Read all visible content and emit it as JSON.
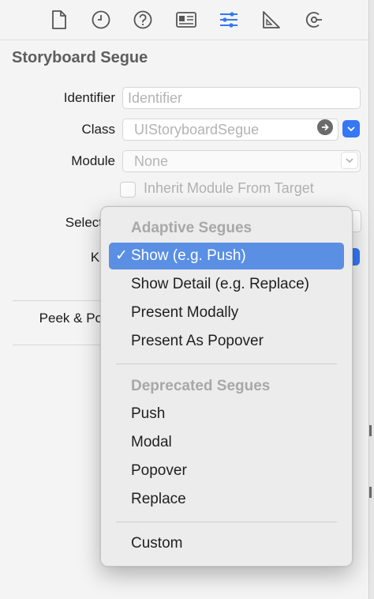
{
  "inspector": {
    "section_title": "Storyboard Segue",
    "identifier": {
      "label": "Identifier",
      "placeholder": "Identifier"
    },
    "class": {
      "label": "Class",
      "value": "UIStoryboardSegue"
    },
    "module": {
      "label": "Module",
      "value": "None"
    },
    "inherit_module": {
      "label": "Inherit Module From Target",
      "checked": false
    },
    "selector": {
      "label": "Select"
    },
    "kind": {
      "label": "Ki"
    },
    "peek_pop": {
      "label": "Peek & Po"
    }
  },
  "toolbar": {
    "icons": [
      "file-inspector-icon",
      "history-inspector-icon",
      "quick-help-icon",
      "identity-inspector-icon",
      "attributes-inspector-icon",
      "size-inspector-icon",
      "connections-inspector-icon"
    ],
    "active_index": 4
  },
  "menu": {
    "header_adaptive": "Adaptive Segues",
    "adaptive_items": [
      {
        "label": "Show (e.g. Push)",
        "selected": true,
        "check": "✓"
      },
      {
        "label": "Show Detail (e.g. Replace)"
      },
      {
        "label": "Present Modally"
      },
      {
        "label": "Present As Popover"
      }
    ],
    "header_deprecated": "Deprecated Segues",
    "deprecated_items": [
      {
        "label": "Push"
      },
      {
        "label": "Modal"
      },
      {
        "label": "Popover"
      },
      {
        "label": "Replace"
      }
    ],
    "custom_item": {
      "label": "Custom"
    }
  },
  "colors": {
    "accent": "#3478f6",
    "menu_highlight": "#5a8fe4",
    "background": "#f4f4f4"
  }
}
